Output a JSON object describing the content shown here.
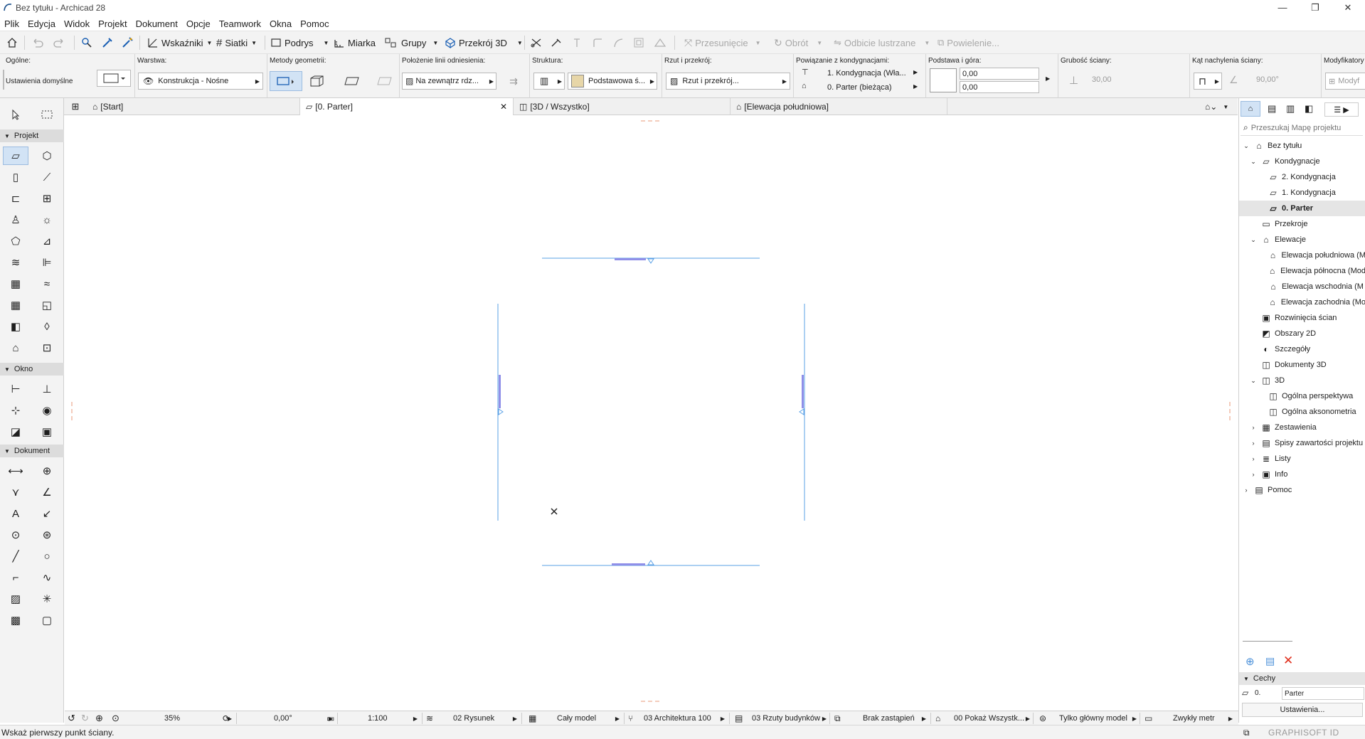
{
  "window": {
    "title": "Bez tytułu - Archicad 28",
    "minimize": "—",
    "maximize": "❐",
    "close": "✕"
  },
  "menu": [
    "Plik",
    "Edycja",
    "Widok",
    "Projekt",
    "Dokument",
    "Opcje",
    "Teamwork",
    "Okna",
    "Pomoc"
  ],
  "toolbar": {
    "wskazniki": "Wskaźniki",
    "siatki": "Siatki",
    "podrys": "Podrys",
    "miarka": "Miarka",
    "grupy": "Grupy",
    "przekroj3d": "Przekrój 3D",
    "przesuniecie": "Przesunięcie",
    "obrot": "Obrót",
    "odbicie": "Odbicie lustrzane",
    "powielenie": "Powielenie..."
  },
  "infobox": {
    "ogolne": {
      "label": "Ogólne:",
      "value": "Ustawienia domyślne"
    },
    "warstwa": {
      "label": "Warstwa:",
      "value": "Konstrukcja - Nośne"
    },
    "metody": {
      "label": "Metody geometrii:"
    },
    "polozenie": {
      "label": "Położenie linii odniesienia:",
      "value": "Na zewnątrz rdz..."
    },
    "struktura": {
      "label": "Struktura:",
      "value": "Podstawowa ś..."
    },
    "rzut": {
      "label": "Rzut i przekrój:",
      "value": "Rzut i przekrój..."
    },
    "powiazanie": {
      "label": "Powiązanie z kondygnacjami:",
      "top": "1. Kondygnacja (Wła...",
      "bottom": "0. Parter (bieżąca)"
    },
    "podstawa": {
      "label": "Podstawa i góra:",
      "top": "0,00",
      "bottom": "0,00"
    },
    "grubosc": {
      "label": "Grubość ściany:",
      "value": "30,00"
    },
    "kat": {
      "label": "Kąt nachylenia ściany:",
      "value": "90,00°"
    },
    "modyfikatory": {
      "label": "Modyfikatory",
      "value": "Modyf"
    }
  },
  "tabs": [
    "[Start]",
    "[0. Parter]",
    "[3D / Wszystko]",
    "[Elewacja południowa]"
  ],
  "toolbox": {
    "sections": [
      "Projekt",
      "Okno",
      "Dokument"
    ]
  },
  "navigator": {
    "search_placeholder": "Przeszukaj Mapę projektu",
    "items": [
      {
        "label": "Bez tytułu"
      },
      {
        "label": "Kondygnacje"
      },
      {
        "label": "2. Kondygnacja"
      },
      {
        "label": "1. Kondygnacja"
      },
      {
        "label": "0. Parter"
      },
      {
        "label": "Przekroje"
      },
      {
        "label": "Elewacje"
      },
      {
        "label": "Elewacja południowa (M"
      },
      {
        "label": "Elewacja północna (Mod"
      },
      {
        "label": "Elewacja wschodnia (M"
      },
      {
        "label": "Elewacja zachodnia (Mo"
      },
      {
        "label": "Rozwinięcia ścian"
      },
      {
        "label": "Obszary 2D"
      },
      {
        "label": "Szczegóły"
      },
      {
        "label": "Dokumenty 3D"
      },
      {
        "label": "3D"
      },
      {
        "label": "Ogólna perspektywa"
      },
      {
        "label": "Ogólna aksonometria"
      },
      {
        "label": "Zestawienia"
      },
      {
        "label": "Spisy zawartości projektu"
      },
      {
        "label": "Listy"
      },
      {
        "label": "Info"
      },
      {
        "label": "Pomoc"
      }
    ],
    "cechy_label": "Cechy",
    "cechy_id": "0.",
    "cechy_name": "Parter",
    "ustawienia": "Ustawienia..."
  },
  "bottombar": {
    "zoom": "35%",
    "angle": "0,00°",
    "scale": "1:100",
    "layer_combo": "02 Rysunek",
    "model": "Cały model",
    "pen_set": "03 Architektura 100",
    "mvo": "03 Rzuty budynków",
    "override": "Brak zastąpień",
    "renovation": "00 Pokaż Wszystk...",
    "structure": "Tylko główny model",
    "dimension": "Zwykły metr"
  },
  "status": {
    "text": "Wskaż pierwszy punkt ściany.",
    "brand": "GRAPHISOFT ID"
  },
  "colors": {
    "accent": "#4a90d9",
    "marker": "#8f8fe8",
    "panel": "#f3f3f3",
    "delete": "#e0301e"
  }
}
